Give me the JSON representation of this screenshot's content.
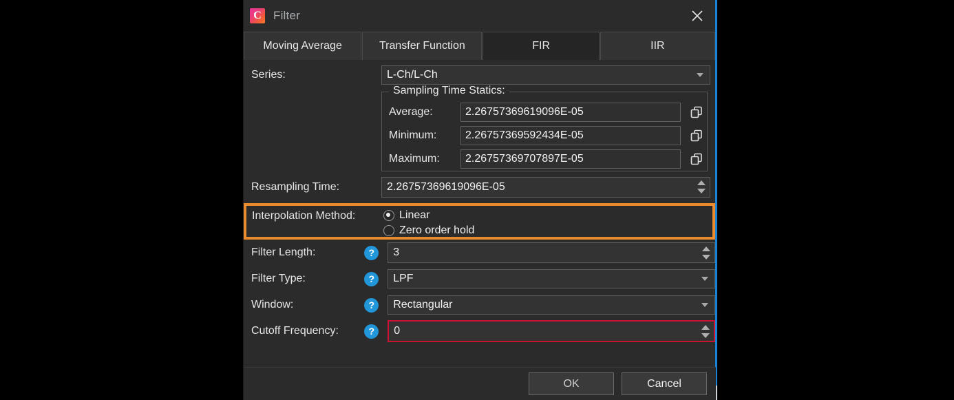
{
  "window": {
    "title": "Filter",
    "app_icon": "app-logo-c-icon",
    "close_icon": "close-icon",
    "accent_color": "#1b83d4"
  },
  "tabs": [
    {
      "label": "Moving Average",
      "selected": false
    },
    {
      "label": "Transfer Function",
      "selected": false
    },
    {
      "label": "FIR",
      "selected": true
    },
    {
      "label": "IIR",
      "selected": false
    }
  ],
  "form": {
    "series": {
      "label": "Series:",
      "value": "L-Ch/L-Ch"
    },
    "sampling_time_statics": {
      "group_label": "Sampling Time Statics:",
      "rows": [
        {
          "label": "Average:",
          "value": "2.26757369619096E-05",
          "copy_icon": "copy-icon"
        },
        {
          "label": "Minimum:",
          "value": "2.26757369592434E-05",
          "copy_icon": "copy-icon"
        },
        {
          "label": "Maximum:",
          "value": "2.26757369707897E-05",
          "copy_icon": "copy-icon"
        }
      ]
    },
    "resampling_time": {
      "label": "Resampling Time:",
      "value": "2.26757369619096E-05"
    },
    "interpolation_method": {
      "label": "Interpolation Method:",
      "highlight_color": "#ea8a2e",
      "options": [
        {
          "label": "Linear",
          "selected": true
        },
        {
          "label": "Zero order hold",
          "selected": false
        }
      ]
    },
    "filter_length": {
      "label": "Filter Length:",
      "help_icon": "help-question-icon",
      "value": "3"
    },
    "filter_type": {
      "label": "Filter Type:",
      "help_icon": "help-question-icon",
      "value": "LPF"
    },
    "window_fn": {
      "label": "Window:",
      "help_icon": "help-question-icon",
      "value": "Rectangular"
    },
    "cutoff_frequency": {
      "label": "Cutoff Frequency:",
      "help_icon": "help-question-icon",
      "value": "0",
      "error_border_color": "#cc1133"
    }
  },
  "buttons": {
    "ok": "OK",
    "cancel": "Cancel"
  }
}
